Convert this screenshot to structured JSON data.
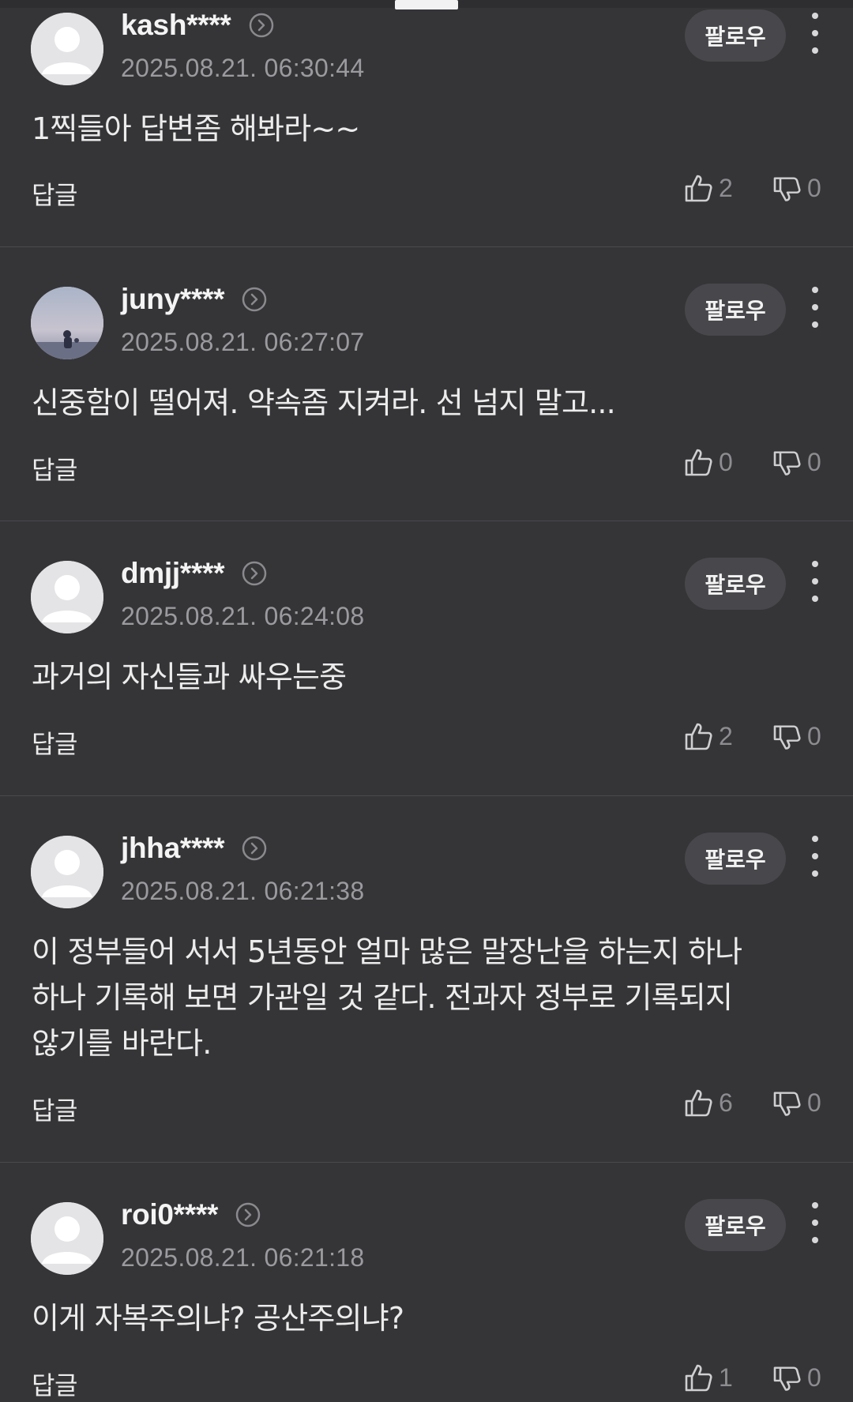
{
  "comments": [
    {
      "username": "kash****",
      "timestamp": "2025.08.21. 06:30:44",
      "body": "1찍들아 답변좀 해봐라~~",
      "follow_label": "팔로우",
      "reply_label": "답글",
      "likes": "2",
      "dislikes": "0",
      "avatar": "default-avatar"
    },
    {
      "username": "juny****",
      "timestamp": "2025.08.21. 06:27:07",
      "body": "신중함이 떨어져. 약속좀 지켜라. 선 넘지 말고...",
      "follow_label": "팔로우",
      "reply_label": "답글",
      "likes": "0",
      "dislikes": "0",
      "avatar": "photo-avatar"
    },
    {
      "username": "dmjj****",
      "timestamp": "2025.08.21. 06:24:08",
      "body": "과거의 자신들과 싸우는중",
      "follow_label": "팔로우",
      "reply_label": "답글",
      "likes": "2",
      "dislikes": "0",
      "avatar": "default-avatar"
    },
    {
      "username": "jhha****",
      "timestamp": "2025.08.21. 06:21:38",
      "body": "이 정부들어 서서 5년동안 얼마 많은 말장난을 하는지 하나 하나 기록해 보면 가관일 것 같다. 전과자 정부로 기록되지 않기를 바란다.",
      "follow_label": "팔로우",
      "reply_label": "답글",
      "likes": "6",
      "dislikes": "0",
      "avatar": "default-avatar"
    },
    {
      "username": "roi0****",
      "timestamp": "2025.08.21. 06:21:18",
      "body": "이게 자복주의냐? 공산주의냐?",
      "follow_label": "팔로우",
      "reply_label": "답글",
      "likes": "1",
      "dislikes": "0",
      "avatar": "default-avatar"
    }
  ],
  "colors": {
    "background": "#353538",
    "divider": "#4a4a4e",
    "follow_button_bg": "#48484c",
    "timestamp": "#9b9b9f",
    "count": "#8d8d91"
  }
}
